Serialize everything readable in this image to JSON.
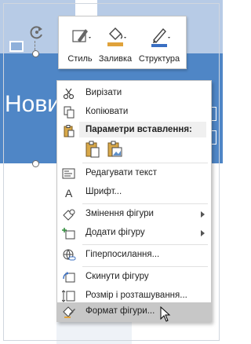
{
  "slide": {
    "title_text": "Нови"
  },
  "mini_toolbar": {
    "style_label": "Стиль",
    "fill_label": "Заливка",
    "outline_label": "Структура",
    "fill_color": "#e0a23a",
    "outline_color": "#3a6fc2"
  },
  "context_menu": {
    "items": [
      {
        "label": "Вирізати",
        "icon": "scissors-icon"
      },
      {
        "label": "Копіювати",
        "icon": "copy-icon"
      },
      {
        "label": "Параметри вставлення:",
        "icon": "paste-icon"
      },
      {
        "label": "Редагувати текст",
        "icon": "edit-text-icon"
      },
      {
        "label": "Шрифт...",
        "icon": "font-icon"
      },
      {
        "label": "Змінення фігури",
        "icon": "change-shape-icon"
      },
      {
        "label": "Додати фігуру",
        "icon": "add-shape-icon"
      },
      {
        "label": "Гіперпосилання...",
        "icon": "hyperlink-icon"
      },
      {
        "label": "Скинути фігуру",
        "icon": "reset-shape-icon"
      },
      {
        "label": "Розмір і розташування...",
        "icon": "size-position-icon"
      },
      {
        "label": "Формат фігури...",
        "icon": "format-shape-icon"
      }
    ],
    "paste_options": [
      "paste-keep-formatting-icon",
      "paste-picture-icon"
    ],
    "highlighted_item": "Формат фігури..."
  },
  "colors": {
    "slide_blue": "#4f86c6",
    "slide_light": "#b7cbe6",
    "highlight": "#c7c7c7"
  }
}
